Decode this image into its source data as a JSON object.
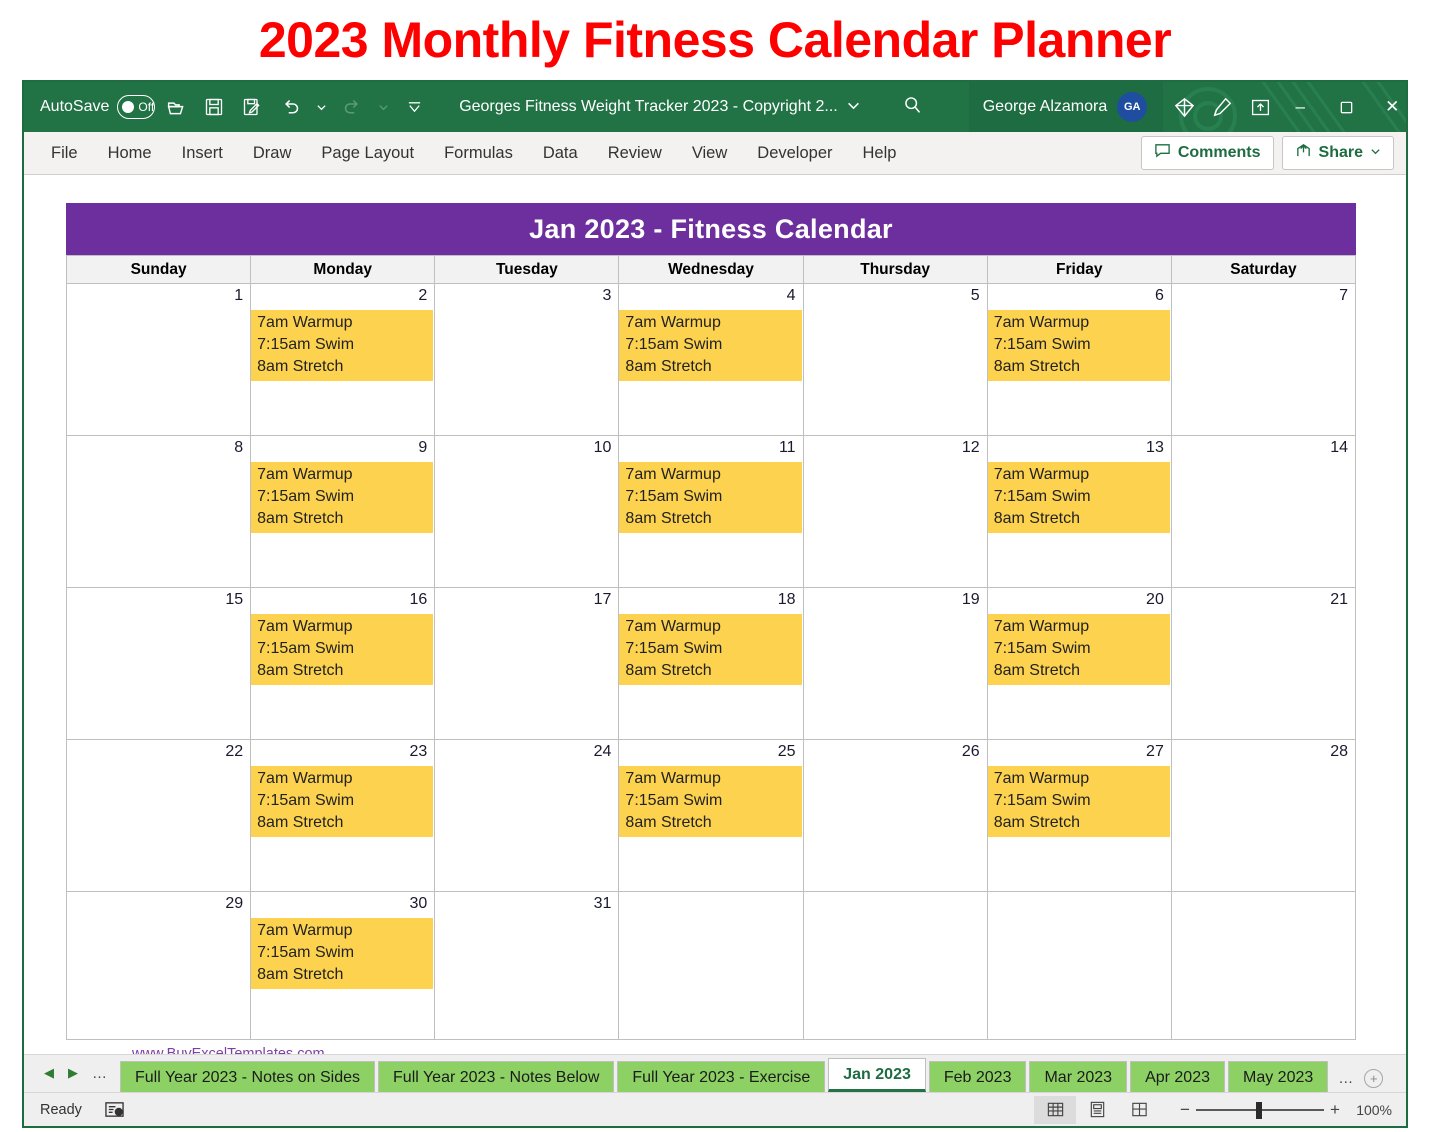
{
  "page_title": "2023 Monthly Fitness Calendar Planner",
  "titlebar": {
    "autosave_label": "AutoSave",
    "autosave_state": "Off",
    "document_title": "Georges Fitness Weight Tracker 2023 - Copyright 2...",
    "account_name": "George Alzamora",
    "account_initials": "GA",
    "icons": [
      "open-folder-icon",
      "save-icon",
      "save-as-icon",
      "undo-icon",
      "redo-icon",
      "customize-quick-access-icon",
      "search-icon",
      "diamond-icon",
      "pen-icon",
      "restore-ribbon-icon"
    ],
    "minimize_label": "–",
    "maximize_label": "▫",
    "close_label": "✕"
  },
  "ribbon": {
    "tabs": [
      "File",
      "Home",
      "Insert",
      "Draw",
      "Page Layout",
      "Formulas",
      "Data",
      "Review",
      "View",
      "Developer",
      "Help"
    ],
    "comments_label": "Comments",
    "share_label": "Share"
  },
  "calendar": {
    "header": "Jan 2023  -  Fitness Calendar",
    "header_bg": "#6E2F9E",
    "workout_bg": "#FCD24F",
    "weekend_bg": "#F0F0F0",
    "blank_bg": "#E3E1EC",
    "weekdays": [
      "Sunday",
      "Monday",
      "Tuesday",
      "Wednesday",
      "Thursday",
      "Friday",
      "Saturday"
    ],
    "workout_lines": [
      "7am Warmup",
      "7:15am Swim",
      "8am Stretch"
    ],
    "footer_link": "www.BuyExcelTemplates.com",
    "weeks": [
      [
        {
          "day": "1",
          "weekend": true,
          "workout": false
        },
        {
          "day": "2",
          "weekend": false,
          "workout": true
        },
        {
          "day": "3",
          "weekend": false,
          "workout": false
        },
        {
          "day": "4",
          "weekend": false,
          "workout": true
        },
        {
          "day": "5",
          "weekend": false,
          "workout": false
        },
        {
          "day": "6",
          "weekend": false,
          "workout": true
        },
        {
          "day": "7",
          "weekend": true,
          "workout": false
        }
      ],
      [
        {
          "day": "8",
          "weekend": true,
          "workout": false
        },
        {
          "day": "9",
          "weekend": false,
          "workout": true
        },
        {
          "day": "10",
          "weekend": false,
          "workout": false
        },
        {
          "day": "11",
          "weekend": false,
          "workout": true
        },
        {
          "day": "12",
          "weekend": false,
          "workout": false
        },
        {
          "day": "13",
          "weekend": false,
          "workout": true
        },
        {
          "day": "14",
          "weekend": true,
          "workout": false
        }
      ],
      [
        {
          "day": "15",
          "weekend": true,
          "workout": false
        },
        {
          "day": "16",
          "weekend": false,
          "workout": true
        },
        {
          "day": "17",
          "weekend": false,
          "workout": false
        },
        {
          "day": "18",
          "weekend": false,
          "workout": true
        },
        {
          "day": "19",
          "weekend": false,
          "workout": false
        },
        {
          "day": "20",
          "weekend": false,
          "workout": true
        },
        {
          "day": "21",
          "weekend": true,
          "workout": false
        }
      ],
      [
        {
          "day": "22",
          "weekend": true,
          "workout": false
        },
        {
          "day": "23",
          "weekend": false,
          "workout": true
        },
        {
          "day": "24",
          "weekend": false,
          "workout": false
        },
        {
          "day": "25",
          "weekend": false,
          "workout": true
        },
        {
          "day": "26",
          "weekend": false,
          "workout": false
        },
        {
          "day": "27",
          "weekend": false,
          "workout": true
        },
        {
          "day": "28",
          "weekend": true,
          "workout": false
        }
      ],
      [
        {
          "day": "29",
          "weekend": true,
          "workout": false
        },
        {
          "day": "30",
          "weekend": false,
          "workout": true
        },
        {
          "day": "31",
          "weekend": false,
          "workout": false
        },
        {
          "day": "",
          "blank": true
        },
        {
          "day": "",
          "blank": true
        },
        {
          "day": "",
          "blank": true
        },
        {
          "day": "",
          "blank": true
        }
      ]
    ]
  },
  "sheet_tabs": {
    "prev_label": "◀",
    "next_label": "▶",
    "ellipsis_left": "…",
    "ellipsis_right": "…",
    "add_label": "+",
    "items": [
      {
        "label": "Full Year 2023 - Notes on Sides",
        "active": false
      },
      {
        "label": "Full Year 2023 - Notes Below",
        "active": false
      },
      {
        "label": "Full Year 2023 - Exercise",
        "active": false
      },
      {
        "label": "Jan 2023",
        "active": true
      },
      {
        "label": "Feb 2023",
        "active": false
      },
      {
        "label": "Mar 2023",
        "active": false
      },
      {
        "label": "Apr 2023",
        "active": false
      },
      {
        "label": "May 2023",
        "active": false
      }
    ]
  },
  "statusbar": {
    "state": "Ready",
    "zoom_minus": "−",
    "zoom_plus": "+",
    "zoom_level": "100%"
  }
}
